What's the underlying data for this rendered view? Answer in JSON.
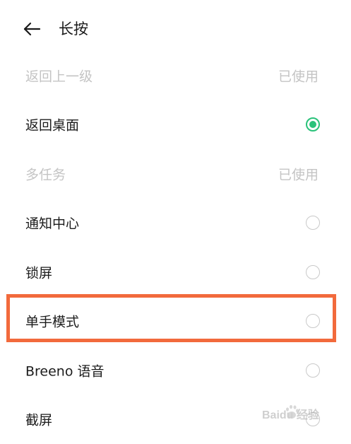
{
  "header": {
    "title": "长按"
  },
  "list": {
    "items": [
      {
        "label": "返回上一级",
        "status": "已使用",
        "state": "disabled"
      },
      {
        "label": "返回桌面",
        "state": "selected"
      },
      {
        "label": "多任务",
        "status": "已使用",
        "state": "disabled"
      },
      {
        "label": "通知中心",
        "state": "unselected"
      },
      {
        "label": "锁屏",
        "state": "unselected"
      },
      {
        "label": "单手模式",
        "state": "unselected"
      },
      {
        "label": "Breeno 语音",
        "state": "unselected"
      },
      {
        "label": "截屏",
        "state": "unselected"
      }
    ]
  },
  "watermark": {
    "text": "Baidu 经验",
    "icon": "baidu-paw-icon"
  },
  "colors": {
    "accent": "#2ac27a",
    "highlight": "#f26a3c",
    "disabled_text": "#c4c4c4",
    "text": "#1c1c1c"
  },
  "icons": {
    "back": "arrow-left-icon"
  }
}
